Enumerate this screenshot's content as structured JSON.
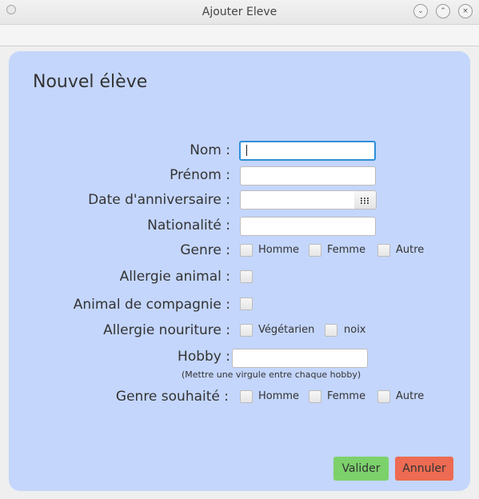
{
  "window": {
    "title": "Ajouter Eleve"
  },
  "form": {
    "heading": "Nouvel élève",
    "nom_label": "Nom :",
    "nom_value": "",
    "prenom_label": "Prénom :",
    "prenom_value": "",
    "date_label": "Date d'anniversaire :",
    "date_value": "",
    "nationalite_label": "Nationalité :",
    "nationalite_value": "",
    "genre_label": "Genre :",
    "genre_options": [
      "Homme",
      "Femme",
      "Autre"
    ],
    "allergie_animal_label": "Allergie animal :",
    "animal_compagnie_label": "Animal de compagnie :",
    "allergie_nourriture_label": "Allergie nouriture :",
    "allergie_nourriture_options": [
      "Végétarien",
      "noix"
    ],
    "hobby_label": "Hobby :",
    "hobby_value": "",
    "hobby_hint": "(Mettre une virgule entre chaque hobby)",
    "genre_souhaite_label": "Genre souhaité :",
    "genre_souhaite_options": [
      "Homme",
      "Femme",
      "Autre"
    ]
  },
  "buttons": {
    "valider": "Valider",
    "annuler": "Annuler"
  },
  "colors": {
    "panel_bg": "#c4d6fc",
    "valider_bg": "#7cd16b",
    "annuler_bg": "#ed6b52"
  },
  "icons": [
    "window-menu-icon",
    "minimize-icon",
    "maximize-icon",
    "calendar-icon"
  ]
}
